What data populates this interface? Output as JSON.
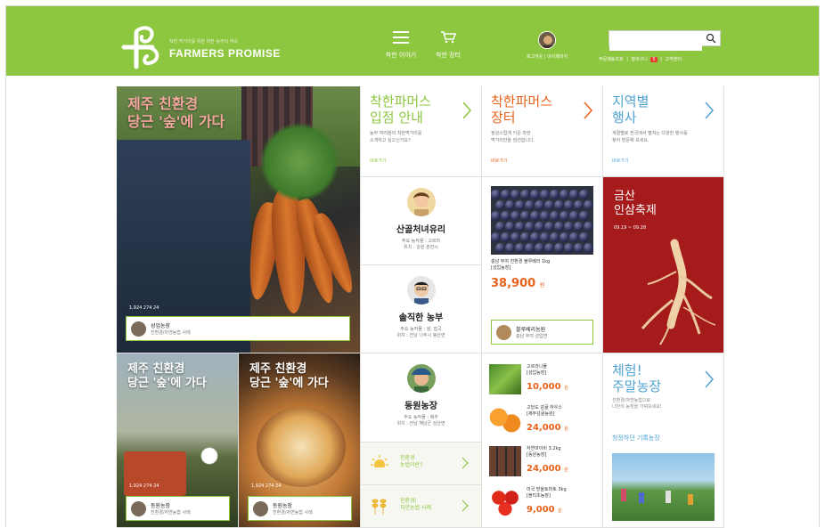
{
  "brand": {
    "tagline": "착한 먹거리를 위한 착한 농부의 약속",
    "name": "FARMERS PROMISE",
    "colors": {
      "green": "#8dc63f",
      "orange": "#e8621c",
      "festival_red": "#a51a1a",
      "blue": "#4fa3d1"
    }
  },
  "nav": {
    "story": {
      "label": "착한 이야기",
      "icon": "menu-icon"
    },
    "market": {
      "label": "착한 장터",
      "icon": "cart-icon"
    }
  },
  "user": {
    "links": "로그아웃 | 마이페이지"
  },
  "search": {
    "placeholder": ""
  },
  "util": {
    "order": "주문배송조회",
    "cart": "장바구니",
    "cart_count": "5",
    "support": "고객센터",
    "sep": "|"
  },
  "hero": {
    "title": "제주 친환경\n당근 '숲'에 가다",
    "stats": "1,924  274  24",
    "farm_name": "성업농장",
    "farm_sub": "친환경/자연농법 사례"
  },
  "tiles": {
    "join": {
      "title": "착한파머스\n입점 안내",
      "desc": "농부 여러분의 착한먹거리를\n소개하고 싶으신가요?",
      "go": "바로가기"
    },
    "market": {
      "title": "착한파머스\n장터",
      "desc": "정성스럽게 키운 착한\n먹거리만을 엄선합니다.",
      "go": "바로가기"
    },
    "event": {
      "title": "지역별\n행사",
      "desc": "계절별로 전국에서 펼쳐는 다양한 행사를\n찾아 방문해 보세요.",
      "go": "바로가기"
    }
  },
  "farmers": [
    {
      "name": "산골처녀유리",
      "meta": "주요 농작물 : 고르라\n위치 : 강원 춘천시"
    },
    {
      "name": "솔직한 농부",
      "meta": "주요 농작물 : 쌀, 잡곡\n위치 : 전남 나주시 봉산면"
    },
    {
      "name": "동원농장",
      "meta": "주요 농작물 : 배추\n위치 : 전남 해남군 삼산면"
    }
  ],
  "product": {
    "name": "충남 부여 친환경 블루베리 1kg\n[성업농장]",
    "price": "38,900",
    "unit": "원",
    "seller_name": "블루베리농원",
    "seller_sub": "충남 부여 성업면"
  },
  "festival": {
    "title": "금산\n인삼축제",
    "date": "09.19 ~ 09.28"
  },
  "small_cards": [
    {
      "title": "제주 친환경\n당근 '숲'에 가다",
      "stats": "1,924  274  24",
      "farm_name": "동원농장",
      "farm_sub": "친환경/자연농법 사례"
    },
    {
      "title": "제주 친환경\n당근 '숲'에 가다",
      "stats": "1,924  274  24",
      "farm_name": "동원농장",
      "farm_sub": "친환경/자연농법 사례"
    }
  ],
  "side_links": [
    {
      "label": "친환경\n농법이란?",
      "icon": "sun-icon"
    },
    {
      "label": "친환경/\n자연농법 사례",
      "icon": "wheat-icon"
    }
  ],
  "mini_products": [
    {
      "name": "고르라니물\n[성업농장]",
      "price": "10,000",
      "unit": "원"
    },
    {
      "name": "고당도 감귤 하우스\n[제주감귤농원]",
      "price": "24,000",
      "unit": "원"
    },
    {
      "name": "자연마이비 3.2kg\n[동원농장]",
      "price": "24,000",
      "unit": "원"
    },
    {
      "name": "미국 방울토마토 3kg\n[블리초농장]",
      "price": "9,000",
      "unit": "원"
    }
  ],
  "experience": {
    "title": "체험!\n주말농장",
    "desc": "친환경/자연농법으로\n나만의 농장을 가꿔보세요!",
    "link": "청정하던 기록농장"
  }
}
